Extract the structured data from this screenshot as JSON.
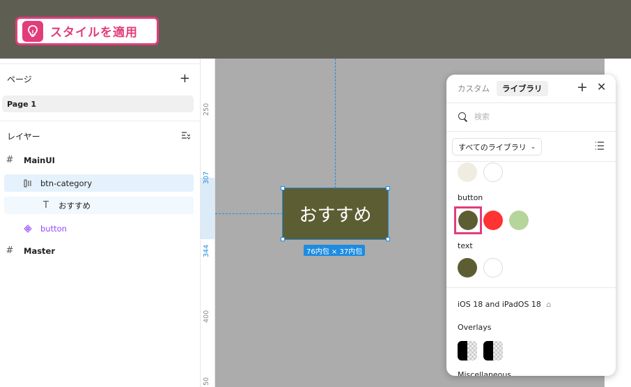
{
  "tip": {
    "label": "スタイルを適用",
    "icon": "lightbulb-icon",
    "color": "#e23c7b"
  },
  "sidebar": {
    "pages_title": "ページ",
    "pages": [
      {
        "label": "Page 1"
      }
    ],
    "layers_title": "レイヤー",
    "layers": [
      {
        "label": "MainUI",
        "icon": "frame-icon"
      },
      {
        "label": "btn-category",
        "icon": "auto-layout-icon"
      },
      {
        "label": "おすすめ",
        "icon": "text-icon"
      },
      {
        "label": "button",
        "icon": "component-icon"
      },
      {
        "label": "Master",
        "icon": "frame-icon"
      }
    ]
  },
  "ruler": {
    "labels": [
      "250",
      "307",
      "344",
      "400",
      "50"
    ]
  },
  "canvas": {
    "button_text": "おすすめ",
    "button_color": "#5d5d33",
    "size_badge": "76内包 × 37内包",
    "background": "#acacac"
  },
  "panel": {
    "tabs": [
      "カスタム",
      "ライブラリ"
    ],
    "active_tab": "ライブラリ",
    "search_placeholder": "検索",
    "library_select": "すべてのライブラリ",
    "groups": [
      {
        "label": "button",
        "colors": [
          "#5d5d33",
          "#ff3333",
          "#b5d59b"
        ]
      },
      {
        "label": "text",
        "colors": [
          "#5d5d33",
          "#ffffff"
        ]
      }
    ],
    "top_colors": [
      "#f0ece1",
      "#ffffff"
    ],
    "library_name": "iOS 18 and iPadOS 18",
    "overlays_label": "Overlays",
    "misc_label": "Miscellaneous"
  }
}
